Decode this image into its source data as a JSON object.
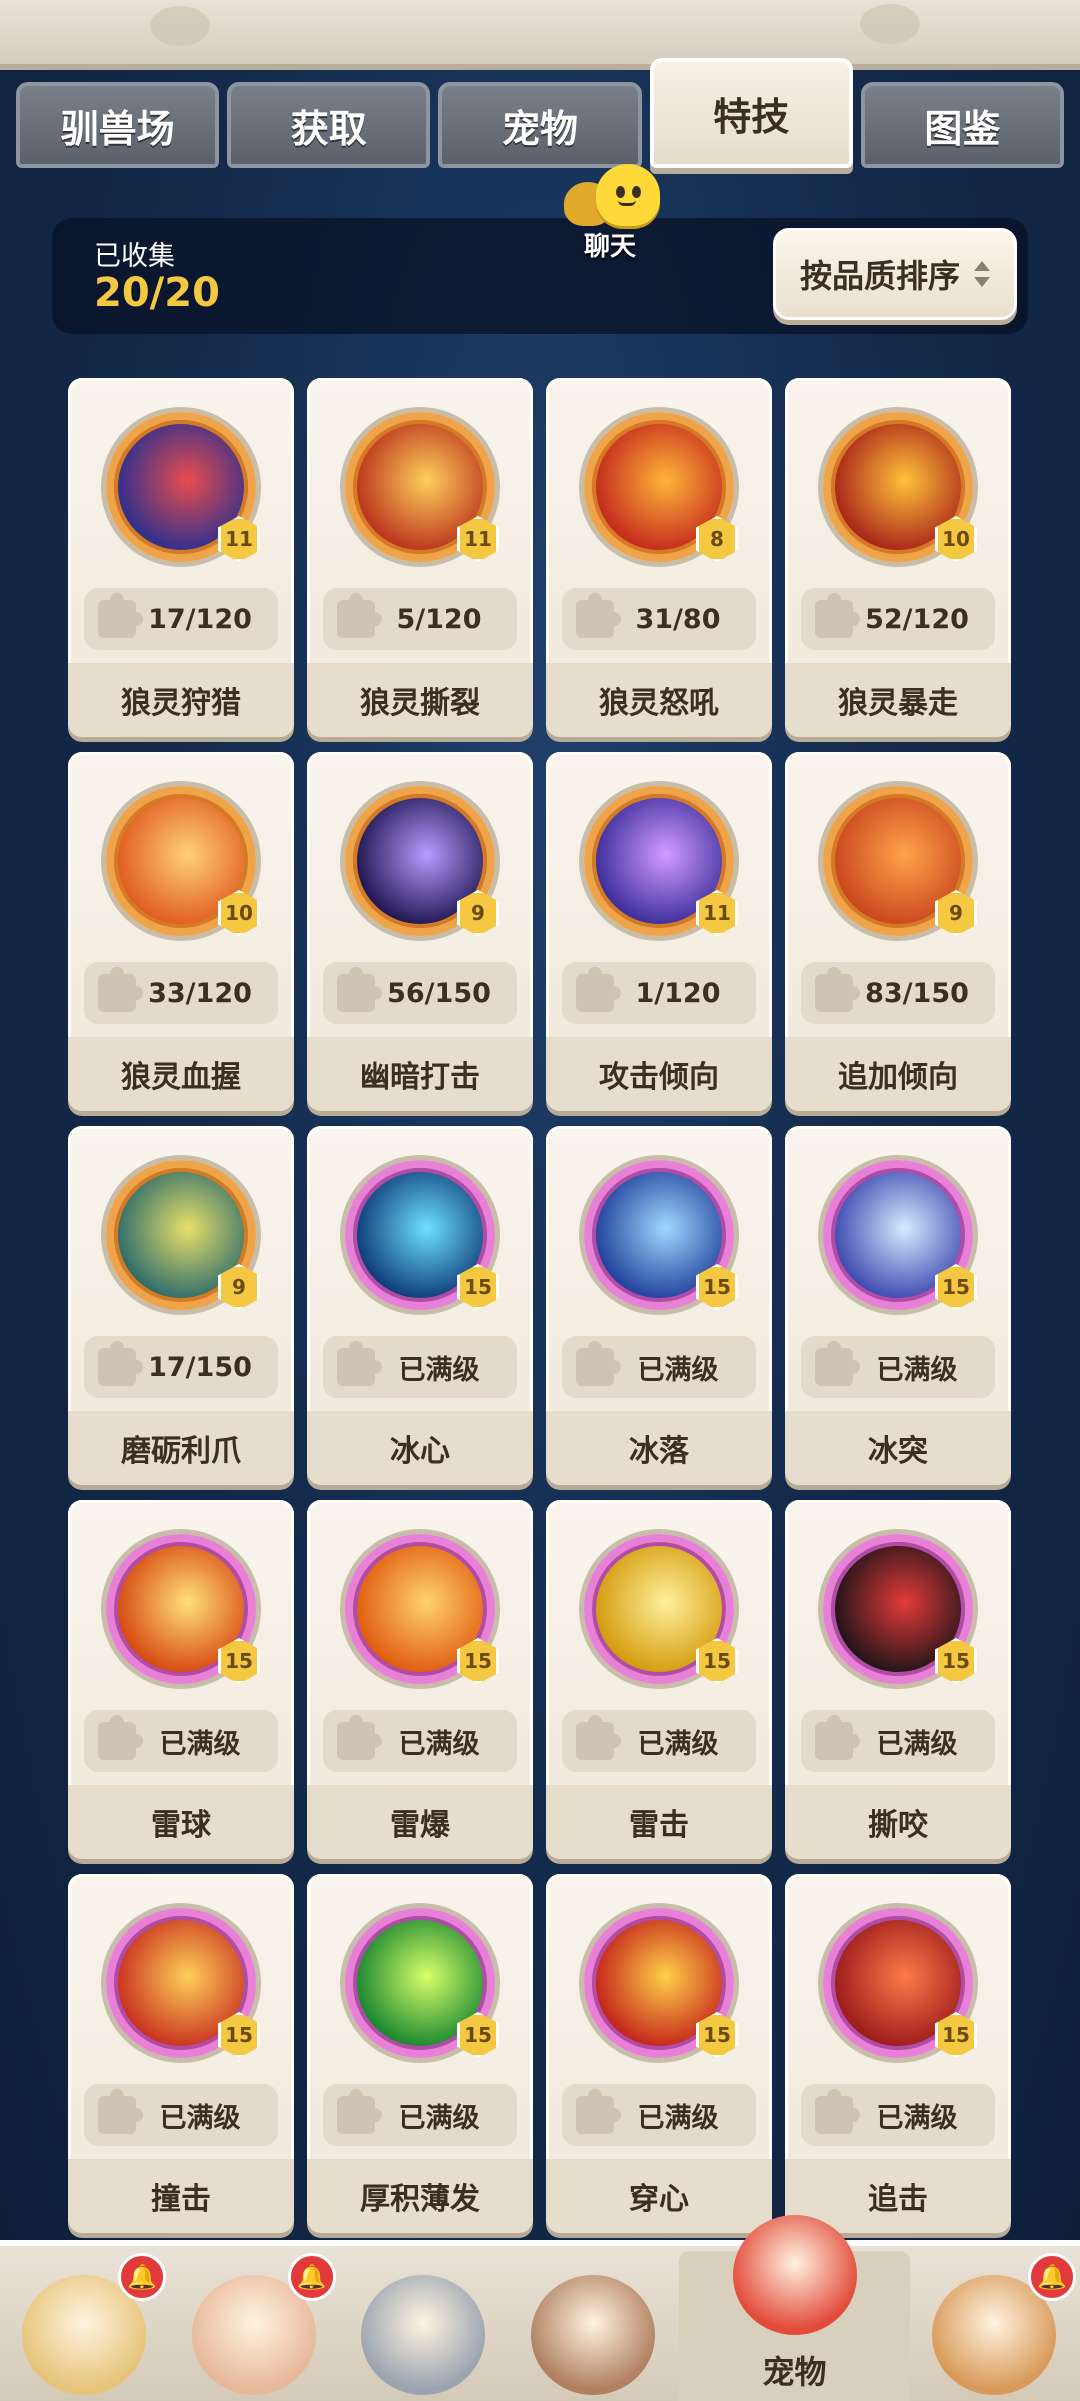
{
  "tabs": [
    {
      "label": "驯兽场",
      "active": false
    },
    {
      "label": "获取",
      "active": false
    },
    {
      "label": "宠物",
      "active": false
    },
    {
      "label": "特技",
      "active": true
    },
    {
      "label": "图鉴",
      "active": false
    }
  ],
  "collection": {
    "label": "已收集",
    "value": "20/20"
  },
  "chat": {
    "label": "聊天"
  },
  "sort": {
    "label": "按品质排序"
  },
  "skills": [
    {
      "name": "狼灵狩猎",
      "level": "11",
      "progress": "17/120",
      "maxed": false,
      "icon": "heart-target-icon",
      "colors": [
        "#2b2f8f",
        "#e94c4c"
      ]
    },
    {
      "name": "狼灵撕裂",
      "level": "11",
      "progress": "5/120",
      "maxed": false,
      "icon": "claw-slash-icon",
      "colors": [
        "#b9321c",
        "#ffce5c"
      ]
    },
    {
      "name": "狼灵怒吼",
      "level": "8",
      "progress": "31/80",
      "maxed": false,
      "icon": "explosion-icon",
      "colors": [
        "#c3281d",
        "#ffb43a"
      ]
    },
    {
      "name": "狼灵暴走",
      "level": "10",
      "progress": "52/120",
      "maxed": false,
      "icon": "fire-slash-icon",
      "colors": [
        "#a8231a",
        "#ffc23a"
      ]
    },
    {
      "name": "狼灵血握",
      "level": "10",
      "progress": "33/120",
      "maxed": false,
      "icon": "paw-icon",
      "colors": [
        "#e05b1f",
        "#ffd07a"
      ]
    },
    {
      "name": "幽暗打击",
      "level": "9",
      "progress": "56/150",
      "maxed": false,
      "icon": "dark-burst-icon",
      "colors": [
        "#1e1450",
        "#b89cff"
      ]
    },
    {
      "name": "攻击倾向",
      "level": "11",
      "progress": "1/120",
      "maxed": false,
      "icon": "wolf-spirit-icon",
      "colors": [
        "#3a2c9a",
        "#d29cff"
      ]
    },
    {
      "name": "追加倾向",
      "level": "9",
      "progress": "83/150",
      "maxed": false,
      "icon": "beast-face-icon",
      "colors": [
        "#c9461e",
        "#ffa34a"
      ]
    },
    {
      "name": "磨砺利爪",
      "level": "9",
      "progress": "17/150",
      "maxed": false,
      "icon": "sharpen-claw-icon",
      "colors": [
        "#2c6b6a",
        "#e8e06a"
      ]
    },
    {
      "name": "冰心",
      "level": "15",
      "progress": "已满级",
      "maxed": true,
      "icon": "snowflake-icon",
      "colors": [
        "#0d3a78",
        "#6de0ff"
      ]
    },
    {
      "name": "冰落",
      "level": "15",
      "progress": "已满级",
      "maxed": true,
      "icon": "ice-shard-icon",
      "colors": [
        "#1f3f9a",
        "#9fd8ff"
      ]
    },
    {
      "name": "冰突",
      "level": "15",
      "progress": "已满级",
      "maxed": true,
      "icon": "ice-crystal-icon",
      "colors": [
        "#3d48b0",
        "#d4ecff"
      ]
    },
    {
      "name": "雷球",
      "level": "15",
      "progress": "已满级",
      "maxed": true,
      "icon": "thunder-orb-icon",
      "colors": [
        "#d6470f",
        "#ffe07a"
      ]
    },
    {
      "name": "雷爆",
      "level": "15",
      "progress": "已满级",
      "maxed": true,
      "icon": "lightning-burst-icon",
      "colors": [
        "#e05a10",
        "#ffd36a"
      ]
    },
    {
      "name": "雷击",
      "level": "15",
      "progress": "已满级",
      "maxed": true,
      "icon": "lightning-strike-icon",
      "colors": [
        "#d39a0c",
        "#fff09a"
      ]
    },
    {
      "name": "撕咬",
      "level": "15",
      "progress": "已满级",
      "maxed": true,
      "icon": "fangs-icon",
      "colors": [
        "#1e1418",
        "#e33a3a"
      ]
    },
    {
      "name": "撞击",
      "level": "15",
      "progress": "已满级",
      "maxed": true,
      "icon": "impact-icon",
      "colors": [
        "#c7301e",
        "#ffcf5a"
      ]
    },
    {
      "name": "厚积薄发",
      "level": "15",
      "progress": "已满级",
      "maxed": true,
      "icon": "hourglass-icon",
      "colors": [
        "#17852f",
        "#d8ff6a"
      ]
    },
    {
      "name": "穿心",
      "level": "15",
      "progress": "已满级",
      "maxed": true,
      "icon": "piercing-fist-icon",
      "colors": [
        "#c3221a",
        "#ffd04a"
      ]
    },
    {
      "name": "追击",
      "level": "15",
      "progress": "已满级",
      "maxed": true,
      "icon": "pursuit-dash-icon",
      "colors": [
        "#9a1a1a",
        "#ff7a4a"
      ]
    }
  ],
  "bottom_nav": [
    {
      "name": "nav-caveman",
      "icon": "caveman-avatar-icon",
      "alert": true,
      "label": "",
      "color": "#e6c47a"
    },
    {
      "name": "nav-hero",
      "icon": "hero-avatar-icon",
      "alert": true,
      "label": "",
      "color": "#e7b89a"
    },
    {
      "name": "nav-equipment",
      "icon": "sword-shield-icon",
      "alert": false,
      "label": "",
      "color": "#9aa4b0"
    },
    {
      "name": "nav-elder",
      "icon": "elder-avatar-icon",
      "alert": false,
      "label": "",
      "color": "#b08060"
    },
    {
      "name": "nav-pet",
      "icon": "dino-pet-icon",
      "alert": false,
      "label": "宠物",
      "active": true,
      "color": "#e24a3a"
    },
    {
      "name": "nav-totem",
      "icon": "totem-icon",
      "alert": true,
      "label": "",
      "color": "#d89a5a"
    }
  ],
  "alert_glyph": "🔔",
  "level_badge_color": "#f5c842",
  "collection_value_color": "#f5c842"
}
